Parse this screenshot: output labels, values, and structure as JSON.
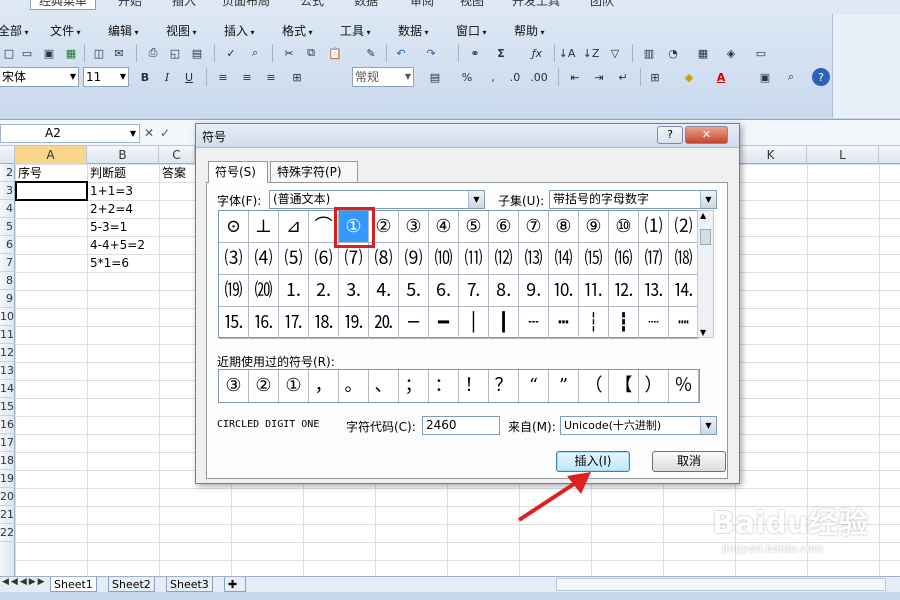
{
  "ribbon": {
    "tabs": [
      "经典菜单",
      "开始",
      "插入",
      "页面布局",
      "公式",
      "数据",
      "审阅",
      "视图",
      "开发工具",
      "团队"
    ],
    "menus": [
      "全部",
      "文件",
      "编辑",
      "视图",
      "插入",
      "格式",
      "工具",
      "数据",
      "窗口",
      "帮助"
    ],
    "font_name": "宋体",
    "font_size": "11",
    "style_combo": "常规"
  },
  "formula_bar": {
    "name_box": "A2",
    "fx": "✓"
  },
  "grid": {
    "columns": [
      "A",
      "B",
      "C",
      "K",
      "L"
    ],
    "rows": [
      "2",
      "3",
      "4",
      "5",
      "6",
      "7",
      "8",
      "9",
      "10",
      "11",
      "12",
      "13",
      "14",
      "15",
      "16",
      "17",
      "18",
      "19",
      "20",
      "21",
      "22"
    ],
    "cells": {
      "a1": "序号",
      "b1": "判断题",
      "c1": "答案",
      "b2": "1+1=3",
      "b3": "2+2=4",
      "b4": "5-3=1",
      "b5": "4-4+5=2",
      "b6": "5*1=6"
    }
  },
  "sheets": [
    "Sheet1",
    "Sheet2",
    "Sheet3"
  ],
  "dialog": {
    "title": "符号",
    "help": "?",
    "close": "✕",
    "tabs": [
      "符号(S)",
      "特殊字符(P)"
    ],
    "font_label": "字体(F):",
    "font_value": "(普通文本)",
    "subset_label": "子集(U):",
    "subset_value": "带括号的字母数字",
    "symbols": [
      [
        "⊙",
        "⊥",
        "⊿",
        "⌒",
        "①",
        "②",
        "③",
        "④",
        "⑤",
        "⑥",
        "⑦",
        "⑧",
        "⑨",
        "⑩",
        "⑴",
        "⑵"
      ],
      [
        "⑶",
        "⑷",
        "⑸",
        "⑹",
        "⑺",
        "⑻",
        "⑼",
        "⑽",
        "⑾",
        "⑿",
        "⒀",
        "⒁",
        "⒂",
        "⒃",
        "⒄",
        "⒅"
      ],
      [
        "⒆",
        "⒇",
        "⒈",
        "⒉",
        "⒊",
        "⒋",
        "⒌",
        "⒍",
        "⒎",
        "⒏",
        "⒐",
        "⒑",
        "⒒",
        "⒓",
        "⒔",
        "⒕"
      ],
      [
        "⒖",
        "⒗",
        "⒘",
        "⒙",
        "⒚",
        "⒛",
        "─",
        "━",
        "│",
        "┃",
        "┄",
        "┅",
        "┆",
        "┇",
        "┈",
        "┉"
      ]
    ],
    "selected_symbol": "①",
    "recent_label": "近期使用过的符号(R):",
    "recent": [
      "③",
      "②",
      "①",
      "，",
      "。",
      "、",
      "；",
      "：",
      "！",
      "？",
      "“",
      "”",
      "（",
      "【",
      "）",
      "％"
    ],
    "char_name": "CIRCLED DIGIT ONE",
    "code_label": "字符代码(C):",
    "code_value": "2460",
    "from_label": "来自(M):",
    "from_value": "Unicode(十六进制)",
    "insert_button": "插入(I)",
    "cancel_button": "取消"
  },
  "watermark": {
    "brand": "Baidu经验",
    "url": "jingyan.baidu.com"
  }
}
